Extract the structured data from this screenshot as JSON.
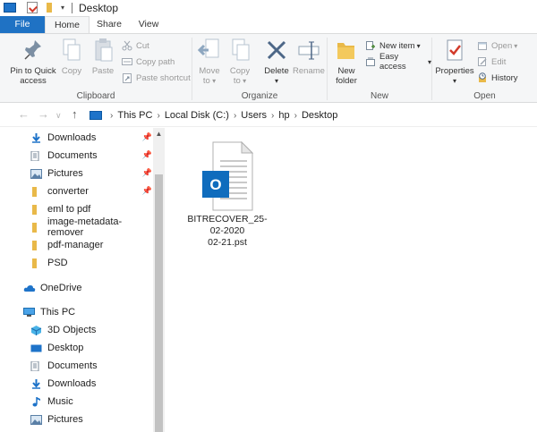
{
  "title_bar": {
    "title": "Desktop",
    "quick_access_dropdown": "▾"
  },
  "tabs": [
    {
      "label": "File"
    },
    {
      "label": "Home"
    },
    {
      "label": "Share"
    },
    {
      "label": "View"
    }
  ],
  "ribbon": {
    "clipboard": {
      "group_label": "Clipboard",
      "pin_to_quick_access": "Pin to Quick access",
      "copy": "Copy",
      "paste": "Paste",
      "cut": "Cut",
      "copy_path": "Copy path",
      "paste_shortcut": "Paste shortcut"
    },
    "organize": {
      "group_label": "Organize",
      "move_to": "Move to",
      "copy_to": "Copy to",
      "delete": "Delete",
      "rename": "Rename"
    },
    "new": {
      "group_label": "New",
      "new_folder": "New folder",
      "new_item": "New item",
      "easy_access": "Easy access"
    },
    "open": {
      "group_label": "Open",
      "properties": "Properties",
      "open": "Open",
      "edit": "Edit",
      "history": "History"
    }
  },
  "address_bar": {
    "breadcrumbs": [
      "This PC",
      "Local Disk (C:)",
      "Users",
      "hp",
      "Desktop"
    ]
  },
  "nav_pane": {
    "items": [
      {
        "label": "Downloads",
        "icon": "download-arrow-icon",
        "pinned": true
      },
      {
        "label": "Documents",
        "icon": "documents-icon",
        "pinned": true
      },
      {
        "label": "Pictures",
        "icon": "pictures-icon",
        "pinned": true
      },
      {
        "label": "converter",
        "icon": "folder-icon",
        "pinned": true
      },
      {
        "label": "eml to pdf",
        "icon": "folder-icon",
        "pinned": false
      },
      {
        "label": "image-metadata-remover",
        "icon": "folder-icon",
        "pinned": false
      },
      {
        "label": "pdf-manager",
        "icon": "folder-icon",
        "pinned": false
      },
      {
        "label": "PSD",
        "icon": "folder-icon",
        "pinned": false
      },
      {
        "label": "OneDrive",
        "icon": "onedrive-cloud-icon",
        "pinned": false
      },
      {
        "label": "This PC",
        "icon": "this-pc-icon",
        "pinned": false
      },
      {
        "label": "3D Objects",
        "icon": "3d-objects-icon",
        "pinned": false
      },
      {
        "label": "Desktop",
        "icon": "desktop-icon",
        "pinned": false
      },
      {
        "label": "Documents",
        "icon": "documents-icon",
        "pinned": false
      },
      {
        "label": "Downloads",
        "icon": "download-arrow-icon",
        "pinned": false
      },
      {
        "label": "Music",
        "icon": "music-note-icon",
        "pinned": false
      },
      {
        "label": "Pictures",
        "icon": "pictures-icon",
        "pinned": false
      }
    ]
  },
  "content": {
    "files": [
      {
        "name_lines": [
          "BITRECOVER_25-",
          "02-2020",
          "02-21.pst"
        ],
        "icon": "outlook-pst-file-icon",
        "badge": "O"
      }
    ]
  },
  "colors": {
    "accent": "#1f72c4",
    "folder": "#e9b949",
    "outlook_blue": "#0f6cbd"
  }
}
